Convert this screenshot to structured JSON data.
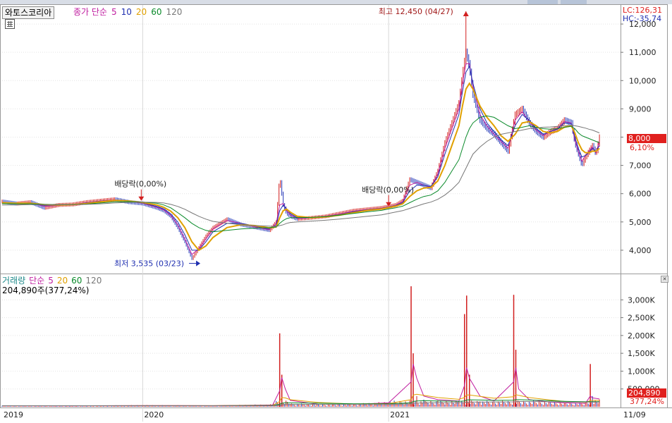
{
  "stock_name": "와토스코리아",
  "price_ma_legend": {
    "label": "종가 단순",
    "periods": [
      "5",
      "10",
      "20",
      "60",
      "120"
    ],
    "colors": [
      "#c01ea0",
      "#1f2fb0",
      "#e0a000",
      "#0a8a2a",
      "#777777"
    ]
  },
  "lc_hc": {
    "lc": "LC:126,31",
    "hc": "HC:-35,74"
  },
  "price_axis": {
    "ticks": [
      "12,000",
      "11,000",
      "10,000",
      "9,000",
      "8,000",
      "7,000",
      "6,000",
      "5,000",
      "4,000"
    ],
    "tick_values": [
      12000,
      11000,
      10000,
      9000,
      8000,
      7000,
      6000,
      5000,
      4000
    ]
  },
  "current": {
    "price": "8,000",
    "pct": "6,10%"
  },
  "annotations": {
    "high": "최고 12,450 (04/27)",
    "low": "최저 3,535 (03/23)",
    "dividend1": "배당락(0,00%)",
    "dividend2": "배당락(0,00%)"
  },
  "volume_legend": {
    "label": "거래량",
    "ma_label": "단순",
    "periods": [
      "5",
      "20",
      "60",
      "120"
    ],
    "colors": [
      "#c01ea0",
      "#e0a000",
      "#0a8a2a",
      "#777777"
    ],
    "value": "204,890주(377,24%)"
  },
  "volume_axis": {
    "ticks": [
      "3,000K",
      "2,500K",
      "2,000K",
      "1,500K",
      "1,000K",
      "500,000"
    ],
    "tick_values": [
      3000,
      2500,
      2000,
      1500,
      1000,
      500
    ]
  },
  "current_volume": {
    "value": "204,890",
    "pct": "377,24%"
  },
  "x_axis": {
    "labels": [
      "2019",
      "2020",
      "2021",
      "11/09"
    ]
  },
  "chart_data": {
    "type": "line",
    "title": "",
    "xlabel": "",
    "ylabel": "",
    "price": {
      "ylim": [
        3200,
        12650
      ],
      "x": [
        0,
        20,
        40,
        60,
        80,
        100,
        120,
        140,
        160,
        180,
        200,
        220,
        230,
        240,
        250,
        260,
        270,
        280,
        290,
        300,
        320,
        340,
        360,
        380,
        390,
        395,
        400,
        405,
        410,
        420,
        440,
        460,
        480,
        500,
        520,
        540,
        550,
        560,
        570,
        580,
        590,
        600,
        610,
        620,
        630,
        640,
        650,
        655,
        660,
        665,
        670,
        680,
        690,
        700,
        710,
        720,
        730,
        740,
        750,
        760,
        770,
        780,
        790,
        800,
        810,
        815,
        820,
        825,
        830,
        835,
        840,
        845,
        850
      ],
      "series": [
        {
          "name": "종가",
          "values": [
            5720,
            5650,
            5700,
            5500,
            5600,
            5620,
            5700,
            5750,
            5800,
            5700,
            5650,
            5500,
            5400,
            5200,
            4800,
            4300,
            3700,
            4100,
            4500,
            4800,
            5100,
            4900,
            4800,
            4700,
            5000,
            6600,
            5600,
            5300,
            5200,
            5100,
            5150,
            5200,
            5300,
            5400,
            5450,
            5500,
            5550,
            5600,
            5750,
            6500,
            6400,
            6300,
            6200,
            6800,
            7800,
            8500,
            9200,
            10200,
            11000,
            10500,
            9500,
            8600,
            8300,
            8100,
            7800,
            7500,
            8800,
            9000,
            8500,
            8200,
            8000,
            8200,
            8300,
            8600,
            8500,
            7800,
            7400,
            7000,
            7300,
            7500,
            7700,
            7400,
            8000
          ]
        },
        {
          "name": "5",
          "values": [
            5700,
            5650,
            5680,
            5550,
            5580,
            5620,
            5680,
            5740,
            5780,
            5720,
            5660,
            5520,
            5430,
            5230,
            4900,
            4400,
            3850,
            4050,
            4400,
            4750,
            5050,
            4950,
            4820,
            4720,
            4950,
            5600,
            5650,
            5400,
            5250,
            5120,
            5150,
            5200,
            5280,
            5380,
            5440,
            5490,
            5540,
            5590,
            5720,
            6300,
            6400,
            6300,
            6220,
            6700,
            7600,
            8300,
            9000,
            9900,
            10600,
            10600,
            9800,
            8800,
            8400,
            8100,
            7850,
            7600,
            8600,
            8900,
            8550,
            8250,
            8050,
            8200,
            8300,
            8550,
            8500,
            7900,
            7500,
            7150,
            7350,
            7500,
            7650,
            7450,
            7850
          ]
        },
        {
          "name": "10",
          "values": [
            5690,
            5660,
            5670,
            5580,
            5590,
            5610,
            5670,
            5730,
            5770,
            5730,
            5670,
            5550,
            5460,
            5280,
            5000,
            4550,
            4000,
            4000,
            4300,
            4650,
            4950,
            4950,
            4850,
            4750,
            4880,
            5400,
            5600,
            5450,
            5300,
            5150,
            5150,
            5190,
            5260,
            5360,
            5430,
            5480,
            5530,
            5580,
            5680,
            6100,
            6300,
            6300,
            6250,
            6600,
            7400,
            8100,
            8800,
            9600,
            10300,
            10500,
            9900,
            9000,
            8500,
            8200,
            7900,
            7700,
            8400,
            8800,
            8600,
            8300,
            8100,
            8200,
            8280,
            8500,
            8480,
            8000,
            7600,
            7300,
            7350,
            7450,
            7600,
            7500,
            7700
          ]
        },
        {
          "name": "20",
          "values": [
            5680,
            5660,
            5660,
            5610,
            5600,
            5610,
            5650,
            5710,
            5760,
            5740,
            5690,
            5600,
            5520,
            5380,
            5150,
            4800,
            4300,
            4000,
            4150,
            4450,
            4800,
            4900,
            4870,
            4790,
            4820,
            5150,
            5400,
            5450,
            5350,
            5200,
            5150,
            5180,
            5240,
            5330,
            5410,
            5460,
            5510,
            5560,
            5640,
            5900,
            6100,
            6200,
            6220,
            6450,
            7000,
            7700,
            8400,
            9100,
            9700,
            9900,
            9700,
            9100,
            8700,
            8400,
            8050,
            7850,
            8100,
            8500,
            8550,
            8400,
            8200,
            8150,
            8200,
            8350,
            8400,
            8150,
            7800,
            7550,
            7450,
            7450,
            7500,
            7500,
            7600
          ]
        },
        {
          "name": "60",
          "values": [
            5650,
            5640,
            5640,
            5620,
            5610,
            5610,
            5630,
            5670,
            5710,
            5720,
            5700,
            5660,
            5600,
            5500,
            5330,
            5150,
            4950,
            4800,
            4700,
            4650,
            4700,
            4750,
            4780,
            4800,
            4820,
            4950,
            5050,
            5120,
            5150,
            5150,
            5160,
            5190,
            5240,
            5300,
            5360,
            5410,
            5460,
            5500,
            5560,
            5680,
            5800,
            5900,
            5950,
            6100,
            6400,
            6800,
            7200,
            7600,
            8000,
            8300,
            8500,
            8700,
            8750,
            8700,
            8550,
            8400,
            8300,
            8350,
            8400,
            8350,
            8300,
            8280,
            8300,
            8350,
            8380,
            8300,
            8150,
            8050,
            8000,
            7950,
            7900,
            7850,
            7800
          ]
        },
        {
          "name": "120",
          "values": [
            5600,
            5600,
            5610,
            5610,
            5610,
            5610,
            5620,
            5640,
            5670,
            5690,
            5700,
            5690,
            5670,
            5620,
            5550,
            5450,
            5320,
            5200,
            5100,
            5020,
            4950,
            4900,
            4870,
            4850,
            4840,
            4870,
            4900,
            4950,
            4980,
            5000,
            5030,
            5060,
            5100,
            5150,
            5200,
            5250,
            5300,
            5350,
            5400,
            5480,
            5560,
            5640,
            5700,
            5800,
            5950,
            6150,
            6400,
            6650,
            6900,
            7150,
            7400,
            7650,
            7850,
            8000,
            8100,
            8150,
            8200,
            8250,
            8300,
            8320,
            8350,
            8360,
            8380,
            8400,
            8420,
            8400,
            8380,
            8350,
            8320,
            8280,
            8250,
            8200,
            8150
          ]
        }
      ]
    },
    "volume": {
      "ylim": [
        0,
        3500
      ],
      "unit": "K",
      "x": [
        0,
        100,
        200,
        300,
        385,
        395,
        398,
        403,
        410,
        450,
        500,
        550,
        582,
        585,
        590,
        600,
        620,
        650,
        658,
        661,
        665,
        680,
        700,
        728,
        731,
        735,
        750,
        780,
        800,
        830,
        837,
        840,
        850
      ],
      "values": [
        30,
        25,
        40,
        30,
        60,
        2060,
        900,
        200,
        80,
        60,
        70,
        120,
        3380,
        1500,
        300,
        200,
        180,
        150,
        2600,
        3120,
        900,
        150,
        120,
        3140,
        1600,
        400,
        150,
        120,
        100,
        90,
        1200,
        300,
        205
      ],
      "ma5": [
        30,
        28,
        35,
        32,
        50,
        450,
        820,
        500,
        180,
        70,
        70,
        110,
        700,
        1200,
        800,
        300,
        200,
        160,
        600,
        1100,
        800,
        300,
        160,
        700,
        1100,
        500,
        200,
        130,
        110,
        95,
        300,
        250,
        220
      ],
      "ma20": [
        30,
        30,
        32,
        32,
        40,
        150,
        260,
        250,
        200,
        120,
        80,
        90,
        200,
        330,
        350,
        320,
        260,
        210,
        260,
        330,
        330,
        290,
        240,
        280,
        340,
        320,
        260,
        190,
        150,
        120,
        170,
        180,
        180
      ],
      "ma60": [
        30,
        30,
        30,
        30,
        35,
        70,
        100,
        110,
        110,
        100,
        85,
        85,
        110,
        150,
        165,
        170,
        165,
        155,
        165,
        190,
        195,
        190,
        180,
        185,
        200,
        200,
        190,
        170,
        155,
        140,
        145,
        145,
        145
      ],
      "ma120": [
        30,
        30,
        30,
        30,
        32,
        45,
        60,
        65,
        68,
        70,
        70,
        72,
        82,
        98,
        105,
        110,
        112,
        112,
        117,
        128,
        132,
        134,
        134,
        138,
        145,
        147,
        146,
        140,
        135,
        130,
        131,
        131,
        131
      ]
    }
  }
}
